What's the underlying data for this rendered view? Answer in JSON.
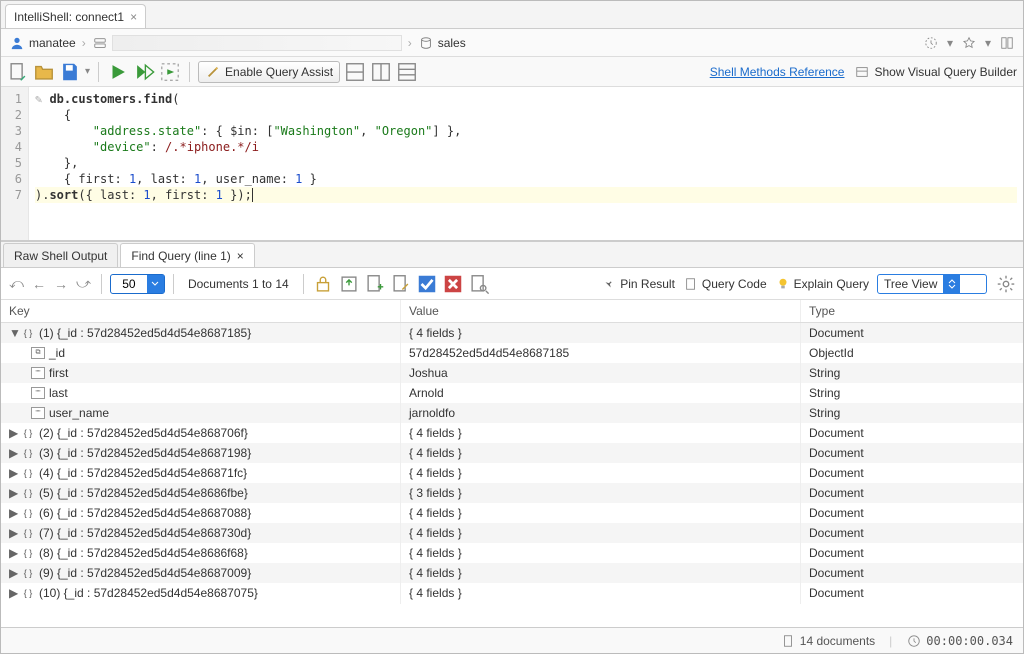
{
  "tab": {
    "title": "IntelliShell: connect1"
  },
  "breadcrumb": {
    "user": "manatee",
    "db": "sales"
  },
  "toolbar": {
    "enable_query_assist": "Enable Query Assist",
    "shell_methods_ref": "Shell Methods Reference",
    "visual_query_builder": "Show Visual Query Builder"
  },
  "editor": {
    "lines": [
      "1",
      "2",
      "3",
      "4",
      "5",
      "6",
      "7"
    ]
  },
  "results_tabs": {
    "raw": "Raw Shell Output",
    "find": "Find Query (line 1)"
  },
  "results_toolbar": {
    "page_size": "50",
    "doc_range": "Documents 1 to 14",
    "pin_result": "Pin Result",
    "query_code": "Query Code",
    "explain_query": "Explain Query",
    "view_mode": "Tree View"
  },
  "columns": {
    "key": "Key",
    "value": "Value",
    "type": "Type"
  },
  "rows": [
    {
      "expanded": true,
      "idx": "(1)",
      "id": "57d28452ed5d4d54e8687185",
      "value": "{ 4 fields }",
      "type": "Document"
    },
    {
      "field": "_id",
      "value": "57d28452ed5d4d54e8687185",
      "type": "ObjectId",
      "child": true
    },
    {
      "field": "first",
      "value": "Joshua",
      "type": "String",
      "child": true
    },
    {
      "field": "last",
      "value": "Arnold",
      "type": "String",
      "child": true
    },
    {
      "field": "user_name",
      "value": "jarnoldfo",
      "type": "String",
      "child": true
    },
    {
      "expanded": false,
      "idx": "(2)",
      "id": "57d28452ed5d4d54e868706f",
      "value": "{ 4 fields }",
      "type": "Document"
    },
    {
      "expanded": false,
      "idx": "(3)",
      "id": "57d28452ed5d4d54e8687198",
      "value": "{ 4 fields }",
      "type": "Document"
    },
    {
      "expanded": false,
      "idx": "(4)",
      "id": "57d28452ed5d4d54e86871fc",
      "value": "{ 4 fields }",
      "type": "Document"
    },
    {
      "expanded": false,
      "idx": "(5)",
      "id": "57d28452ed5d4d54e8686fbe",
      "value": "{ 3 fields }",
      "type": "Document"
    },
    {
      "expanded": false,
      "idx": "(6)",
      "id": "57d28452ed5d4d54e8687088",
      "value": "{ 4 fields }",
      "type": "Document"
    },
    {
      "expanded": false,
      "idx": "(7)",
      "id": "57d28452ed5d4d54e868730d",
      "value": "{ 4 fields }",
      "type": "Document"
    },
    {
      "expanded": false,
      "idx": "(8)",
      "id": "57d28452ed5d4d54e8686f68",
      "value": "{ 4 fields }",
      "type": "Document"
    },
    {
      "expanded": false,
      "idx": "(9)",
      "id": "57d28452ed5d4d54e8687009",
      "value": "{ 4 fields }",
      "type": "Document"
    },
    {
      "expanded": false,
      "idx": "(10)",
      "id": "57d28452ed5d4d54e8687075",
      "value": "{ 4 fields }",
      "type": "Document"
    }
  ],
  "status": {
    "doc_count": "14 documents",
    "time": "00:00:00.034"
  }
}
